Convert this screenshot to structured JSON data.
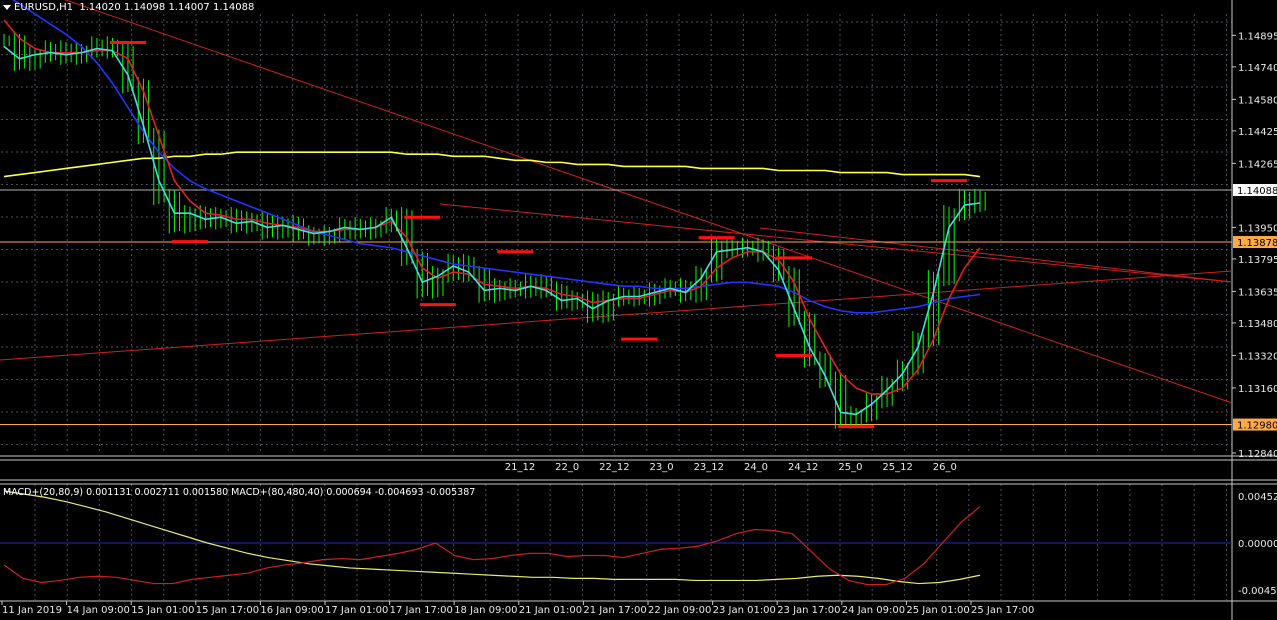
{
  "header": {
    "symbol": "EURUSD,H1",
    "ohlc": "1.14020 1.14098 1.14007 1.14088"
  },
  "macd_header": "MACD+(20,80,9) 0.001131 0.002711 0.001580  MACD+(80,480,40) 0.000694 -0.004693 -0.005387",
  "colors": {
    "background": "#000000",
    "grid": "#4a4f58",
    "candles": "#00ff00",
    "ma_fast": "#40e0e0",
    "ma_mid": "#e02020",
    "ma_slow": "#2233ff",
    "ma_long": "#ffff44",
    "trendlines": "#cc2020",
    "horizontal_levels": "#ffaa44",
    "swing_marks": "#ff1010",
    "macd_line1": "#cc2020",
    "macd_line2": "#e8e870",
    "macd_zero": "#2222dd"
  },
  "chart_data": [
    {
      "type": "line",
      "title": "EURUSD,H1",
      "y_ticks": [
        "1.14895",
        "1.14740",
        "1.14580",
        "1.14425",
        "1.14265",
        "1.13950",
        "1.13795",
        "1.13635",
        "1.13480",
        "1.13320",
        "1.13160",
        "1.12840"
      ],
      "ylim": [
        1.1284,
        1.15
      ],
      "current_price": "1.14088",
      "levels": [
        {
          "label": "1.13878",
          "value": 1.13878
        },
        {
          "label": "1.12980",
          "value": 1.1298
        }
      ],
      "time_ticks": [
        "11 Jan 2019",
        "14 Jan 09:00",
        "15 Jan 01:00",
        "15 Jan 17:00",
        "16 Jan 09:00",
        "17 Jan 01:00",
        "17 Jan 17:00",
        "18 Jan 09:00",
        "21 Jan 01:00",
        "21 Jan 17:00",
        "22 Jan 09:00",
        "23 Jan 01:00",
        "23 Jan 17:00",
        "24 Jan 09:00",
        "25 Jan 01:00",
        "25 Jan 17:00"
      ],
      "session_ticks": [
        "21_12",
        "22_0",
        "22_12",
        "23_0",
        "23_12",
        "24_0",
        "24_12",
        "25_0",
        "25_12",
        "26_0"
      ],
      "series": [
        {
          "name": "",
          "role": "price",
          "values": [
            1.1487,
            1.1476,
            1.148,
            1.1483,
            1.1479,
            1.1482,
            1.1485,
            1.1482,
            1.1465,
            1.144,
            1.141,
            1.1396,
            1.1402,
            1.1398,
            1.1401,
            1.1396,
            1.1399,
            1.1393,
            1.1397,
            1.1392,
            1.139,
            1.1392,
            1.1396,
            1.1393,
            1.1396,
            1.1401,
            1.138,
            1.1364,
            1.1372,
            1.1378,
            1.1372,
            1.1362,
            1.1366,
            1.1364,
            1.1368,
            1.1364,
            1.1358,
            1.136,
            1.1352,
            1.136,
            1.1362,
            1.136,
            1.1364,
            1.1366,
            1.1362,
            1.1372,
            1.1386,
            1.1384,
            1.1386,
            1.1382,
            1.1372,
            1.135,
            1.133,
            1.132,
            1.13,
            1.1303,
            1.131,
            1.1318,
            1.1326,
            1.134,
            1.137,
            1.1402,
            1.141,
            1.1406
          ]
        },
        {
          "name": "",
          "role": "ma_fast",
          "values": [
            1.1484,
            1.1478,
            1.148,
            1.1481,
            1.148,
            1.1481,
            1.1483,
            1.1482,
            1.147,
            1.1445,
            1.1418,
            1.1402,
            1.1402,
            1.1399,
            1.14,
            1.1397,
            1.1398,
            1.1395,
            1.1396,
            1.1394,
            1.1392,
            1.1393,
            1.1395,
            1.1394,
            1.1395,
            1.14,
            1.1385,
            1.1368,
            1.1371,
            1.1376,
            1.1373,
            1.1364,
            1.1365,
            1.1364,
            1.1366,
            1.1364,
            1.1359,
            1.136,
            1.1355,
            1.1359,
            1.1361,
            1.1361,
            1.1363,
            1.1365,
            1.1363,
            1.137,
            1.1383,
            1.1384,
            1.1385,
            1.1383,
            1.1374,
            1.1355,
            1.1336,
            1.1322,
            1.1304,
            1.1303,
            1.1308,
            1.1315,
            1.1323,
            1.1336,
            1.1363,
            1.1395,
            1.1406,
            1.1407
          ]
        },
        {
          "name": "",
          "role": "ma_mid",
          "values": [
            1.1497,
            1.1488,
            1.1483,
            1.1481,
            1.1481,
            1.1481,
            1.1482,
            1.1482,
            1.1478,
            1.1462,
            1.144,
            1.1418,
            1.1408,
            1.1402,
            1.1401,
            1.1399,
            1.1399,
            1.1397,
            1.1396,
            1.1395,
            1.1393,
            1.1393,
            1.1394,
            1.1394,
            1.1395,
            1.1398,
            1.139,
            1.1375,
            1.137,
            1.1373,
            1.1372,
            1.1367,
            1.1366,
            1.1365,
            1.1366,
            1.1365,
            1.1362,
            1.1361,
            1.1358,
            1.1359,
            1.136,
            1.136,
            1.1362,
            1.1364,
            1.1363,
            1.1366,
            1.1375,
            1.138,
            1.1383,
            1.1383,
            1.1379,
            1.1368,
            1.135,
            1.1336,
            1.1323,
            1.1316,
            1.1313,
            1.1313,
            1.1316,
            1.1325,
            1.134,
            1.136,
            1.1375,
            1.1385
          ]
        },
        {
          "name": "",
          "role": "ma_slow",
          "values": [
            1.151,
            1.1505,
            1.15,
            1.1495,
            1.149,
            1.1484,
            1.1476,
            1.1466,
            1.1454,
            1.1442,
            1.1432,
            1.1424,
            1.1418,
            1.1414,
            1.1411,
            1.1408,
            1.1405,
            1.1402,
            1.1399,
            1.1396,
            1.1393,
            1.1391,
            1.1389,
            1.1387,
            1.1386,
            1.1385,
            1.1383,
            1.1381,
            1.1379,
            1.1377,
            1.1376,
            1.1375,
            1.1374,
            1.1373,
            1.1372,
            1.1371,
            1.137,
            1.1369,
            1.1368,
            1.1367,
            1.1366,
            1.1366,
            1.1365,
            1.1365,
            1.1365,
            1.1366,
            1.1367,
            1.1368,
            1.1368,
            1.1367,
            1.1366,
            1.1363,
            1.1359,
            1.1356,
            1.1354,
            1.1353,
            1.1353,
            1.1354,
            1.1355,
            1.1356,
            1.1358,
            1.136,
            1.1361,
            1.1362
          ]
        },
        {
          "name": "",
          "role": "ma_long",
          "values": [
            1.142,
            1.1421,
            1.1422,
            1.1423,
            1.1424,
            1.1425,
            1.1426,
            1.1427,
            1.1428,
            1.1429,
            1.1429,
            1.143,
            1.143,
            1.1431,
            1.1431,
            1.1432,
            1.1432,
            1.1432,
            1.1432,
            1.1432,
            1.1432,
            1.1432,
            1.1432,
            1.1432,
            1.1432,
            1.1432,
            1.1431,
            1.1431,
            1.1431,
            1.143,
            1.143,
            1.143,
            1.1429,
            1.1428,
            1.1428,
            1.1427,
            1.1427,
            1.1426,
            1.1426,
            1.1426,
            1.1425,
            1.1425,
            1.1425,
            1.1425,
            1.1425,
            1.1424,
            1.1424,
            1.1424,
            1.1424,
            1.1424,
            1.1423,
            1.1423,
            1.1423,
            1.1423,
            1.1422,
            1.1422,
            1.1422,
            1.1422,
            1.1421,
            1.1421,
            1.1421,
            1.1421,
            1.1421,
            1.142
          ]
        }
      ]
    },
    {
      "type": "line",
      "title": "MACD+(20,80,9)",
      "y_ticks": [
        "0.004526",
        "0.000000",
        "-0.004526"
      ],
      "ylim": [
        -0.005,
        0.005
      ],
      "series": [
        {
          "name": "",
          "role": "macd_line1",
          "values": [
            -0.0021,
            -0.0034,
            -0.0038,
            -0.0036,
            -0.0033,
            -0.0032,
            -0.0033,
            -0.0036,
            -0.0039,
            -0.0039,
            -0.0035,
            -0.0033,
            -0.0031,
            -0.0029,
            -0.0024,
            -0.0021,
            -0.0019,
            -0.0016,
            -0.0015,
            -0.0016,
            -0.0013,
            -0.001,
            -0.0006,
            0.0,
            -0.0012,
            -0.0016,
            -0.0015,
            -0.0012,
            -0.001,
            -0.001,
            -0.0013,
            -0.0012,
            -0.0012,
            -0.0014,
            -0.001,
            -0.0006,
            -0.0005,
            -0.0003,
            0.0002,
            0.0009,
            0.0013,
            0.0012,
            0.0009,
            -0.0008,
            -0.0025,
            -0.0036,
            -0.004,
            -0.004,
            -0.0034,
            -0.002,
            0.0,
            0.002,
            0.0035
          ]
        },
        {
          "name": "",
          "role": "macd_line2",
          "values": [
            0.005,
            0.0047,
            0.0044,
            0.004,
            0.0035,
            0.003,
            0.0024,
            0.0018,
            0.0012,
            0.0006,
            0.0,
            -0.0005,
            -0.001,
            -0.0014,
            -0.0017,
            -0.002,
            -0.0022,
            -0.0024,
            -0.0025,
            -0.0026,
            -0.0027,
            -0.0028,
            -0.0029,
            -0.003,
            -0.0031,
            -0.0032,
            -0.0033,
            -0.0033,
            -0.0034,
            -0.0034,
            -0.0035,
            -0.0035,
            -0.0035,
            -0.0035,
            -0.0036,
            -0.0036,
            -0.0036,
            -0.0036,
            -0.0035,
            -0.0034,
            -0.0032,
            -0.0031,
            -0.0032,
            -0.0034,
            -0.0037,
            -0.0039,
            -0.0038,
            -0.0035,
            -0.0031
          ]
        }
      ]
    }
  ]
}
